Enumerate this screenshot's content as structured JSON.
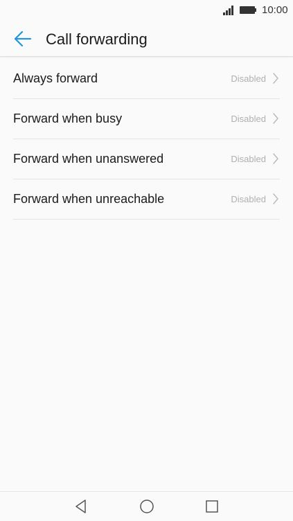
{
  "status_bar": {
    "time": "10:00"
  },
  "header": {
    "title": "Call forwarding",
    "back_icon": "arrow-left-icon",
    "accent_color": "#2196d8"
  },
  "items": [
    {
      "label": "Always forward",
      "status": "Disabled"
    },
    {
      "label": "Forward when busy",
      "status": "Disabled"
    },
    {
      "label": "Forward when unanswered",
      "status": "Disabled"
    },
    {
      "label": "Forward when unreachable",
      "status": "Disabled"
    }
  ],
  "nav_bar": {
    "back_icon": "triangle-back-icon",
    "home_icon": "circle-home-icon",
    "recents_icon": "square-recents-icon"
  }
}
